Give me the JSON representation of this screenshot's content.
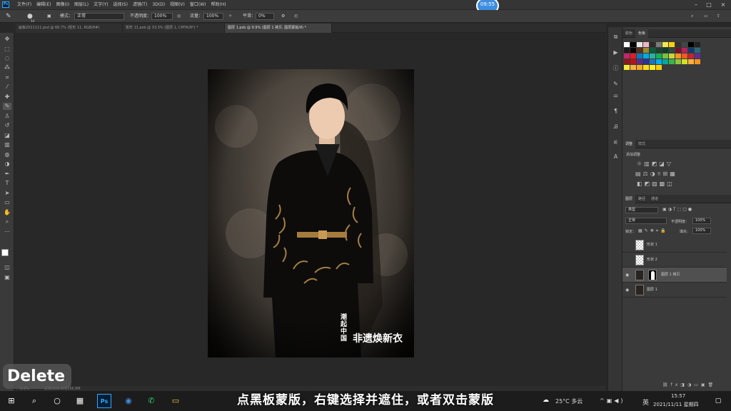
{
  "app": {
    "logo": "Ps"
  },
  "menu": [
    "文件(F)",
    "编辑(E)",
    "图像(I)",
    "图层(L)",
    "文字(Y)",
    "选择(S)",
    "滤镜(T)",
    "3D(D)",
    "视图(V)",
    "窗口(W)",
    "帮助(H)"
  ],
  "timer": "09:55",
  "options": {
    "size": "54",
    "mode_label": "模式：",
    "mode_value": "正常",
    "opacity_label": "不透明度：",
    "opacity_value": "100%",
    "flow_label": "流量：",
    "flow_value": "100%",
    "smooth_label": "平滑：",
    "smooth_value": "0%"
  },
  "tabs": [
    "画板2021111.psd @ 66.7% (矩形 11, RGB/8#)",
    "矩形 11.psb @ 33.3% (图层 1, CMYK/8*) *",
    "图层 1.psb @ 9.9% (图层 1 拷贝, 图层蒙版/8) *"
  ],
  "status": {
    "zoom": "9.9%",
    "doc": "文档:133.9M/336.8M"
  },
  "artwork": {
    "logo_text": "非遗焕新衣",
    "logo_vertical": "潮起中国"
  },
  "swatches_tabs": [
    "颜色",
    "色板"
  ],
  "adjust_tabs": [
    "调整",
    "样式"
  ],
  "adjust_title": "添加调整",
  "layers_tabs": [
    "图层",
    "路径",
    "通道"
  ],
  "layers_filter": "类型",
  "blend_mode": "正常",
  "opacity_label": "不透明度：",
  "opacity_value": "100%",
  "lock_label": "锁定：",
  "fill_label": "填充：",
  "fill_value": "100%",
  "layers": [
    {
      "name": "形状 1",
      "visible": false,
      "selected": false,
      "mask": false
    },
    {
      "name": "形状 2",
      "visible": false,
      "selected": false,
      "mask": false
    },
    {
      "name": "图层 1 拷贝",
      "visible": true,
      "selected": true,
      "mask": true
    },
    {
      "name": "图层 1",
      "visible": true,
      "selected": false,
      "mask": false
    }
  ],
  "subtitle": "点黑板蒙版，右键选择并遮住，或者双击蒙版",
  "delete_key": "Delete",
  "taskbar": {
    "weather": "25°C 多云",
    "ime": "英",
    "time": "15:57",
    "date": "2021/11/11 星期四"
  },
  "colors": {
    "ps_blue": "#31a8ff",
    "timer": "#3e8ee0",
    "selected_layer": "#505050"
  }
}
